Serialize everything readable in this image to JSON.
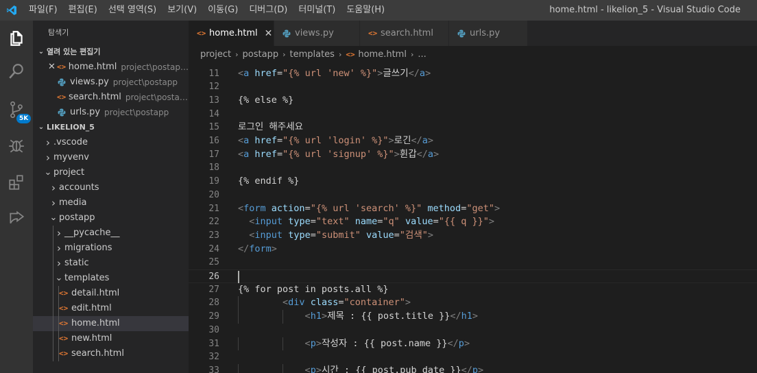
{
  "titlebar": {
    "menu": [
      "파일(F)",
      "편집(E)",
      "선택 영역(S)",
      "보기(V)",
      "이동(G)",
      "디버그(D)",
      "터미널(T)",
      "도움말(H)"
    ],
    "window_title": "home.html - likelion_5 - Visual Studio Code"
  },
  "activitybar": {
    "items": [
      "explorer-icon",
      "search-icon",
      "source-control-icon",
      "debug-icon",
      "extensions-icon",
      "remote-share-icon"
    ],
    "scm_badge": "5K",
    "accent": "#007acc"
  },
  "sidebar": {
    "title": "탐색기",
    "open_editors": {
      "header": "열려 있는 편집기",
      "items": [
        {
          "name": "home.html",
          "path": "project\\postapp...",
          "type": "html"
        },
        {
          "name": "views.py",
          "path": "project\\postapp",
          "type": "py"
        },
        {
          "name": "search.html",
          "path": "project\\postap...",
          "type": "html"
        },
        {
          "name": "urls.py",
          "path": "project\\postapp",
          "type": "py"
        }
      ]
    },
    "workspace": {
      "header": "LIKELION_5",
      "tree": [
        {
          "name": ".vscode",
          "kind": "folder",
          "expanded": false,
          "depth": 0
        },
        {
          "name": "myvenv",
          "kind": "folder",
          "expanded": false,
          "depth": 0
        },
        {
          "name": "project",
          "kind": "folder",
          "expanded": true,
          "depth": 0
        },
        {
          "name": "accounts",
          "kind": "folder",
          "expanded": false,
          "depth": 1
        },
        {
          "name": "media",
          "kind": "folder",
          "expanded": false,
          "depth": 1
        },
        {
          "name": "postapp",
          "kind": "folder",
          "expanded": true,
          "depth": 1
        },
        {
          "name": "__pycache__",
          "kind": "folder",
          "expanded": false,
          "depth": 2
        },
        {
          "name": "migrations",
          "kind": "folder",
          "expanded": false,
          "depth": 2
        },
        {
          "name": "static",
          "kind": "folder",
          "expanded": false,
          "depth": 2
        },
        {
          "name": "templates",
          "kind": "folder",
          "expanded": true,
          "depth": 2
        },
        {
          "name": "detail.html",
          "kind": "html",
          "depth": 3
        },
        {
          "name": "edit.html",
          "kind": "html",
          "depth": 3
        },
        {
          "name": "home.html",
          "kind": "html",
          "depth": 3,
          "selected": true
        },
        {
          "name": "new.html",
          "kind": "html",
          "depth": 3
        },
        {
          "name": "search.html",
          "kind": "html",
          "depth": 3
        }
      ]
    }
  },
  "tabs": [
    {
      "label": "home.html",
      "type": "html",
      "active": true
    },
    {
      "label": "views.py",
      "type": "py",
      "active": false
    },
    {
      "label": "search.html",
      "type": "html",
      "active": false
    },
    {
      "label": "urls.py",
      "type": "py",
      "active": false
    }
  ],
  "breadcrumb": [
    "project",
    "postapp",
    "templates",
    "home.html",
    "..."
  ],
  "editor": {
    "current_line": 26,
    "lines": [
      {
        "n": 11,
        "tokens": [
          [
            "t-br",
            "<"
          ],
          [
            "t-tag",
            "a"
          ],
          [
            "t-txt",
            " "
          ],
          [
            "t-attr",
            "href"
          ],
          [
            "t-txt",
            "="
          ],
          [
            "t-str",
            "\"{% url 'new' %}\""
          ],
          [
            "t-br",
            ">"
          ],
          [
            "t-txt",
            "글쓰기"
          ],
          [
            "t-br",
            "</"
          ],
          [
            "t-tag",
            "a"
          ],
          [
            "t-br",
            ">"
          ]
        ]
      },
      {
        "n": 12,
        "tokens": []
      },
      {
        "n": 13,
        "tokens": [
          [
            "t-txt",
            "{% else %}"
          ]
        ]
      },
      {
        "n": 14,
        "tokens": []
      },
      {
        "n": 15,
        "tokens": [
          [
            "t-txt",
            "로그인 해주세요"
          ]
        ]
      },
      {
        "n": 16,
        "tokens": [
          [
            "t-br",
            "<"
          ],
          [
            "t-tag",
            "a"
          ],
          [
            "t-txt",
            " "
          ],
          [
            "t-attr",
            "href"
          ],
          [
            "t-txt",
            "="
          ],
          [
            "t-str",
            "\"{% url 'login' %}\""
          ],
          [
            "t-br",
            ">"
          ],
          [
            "t-txt",
            "로긴"
          ],
          [
            "t-br",
            "</"
          ],
          [
            "t-tag",
            "a"
          ],
          [
            "t-br",
            ">"
          ]
        ]
      },
      {
        "n": 17,
        "tokens": [
          [
            "t-br",
            "<"
          ],
          [
            "t-tag",
            "a"
          ],
          [
            "t-txt",
            " "
          ],
          [
            "t-attr",
            "href"
          ],
          [
            "t-txt",
            "="
          ],
          [
            "t-str",
            "\"{% url 'signup' %}\""
          ],
          [
            "t-br",
            ">"
          ],
          [
            "t-txt",
            "휜갑"
          ],
          [
            "t-br",
            "</"
          ],
          [
            "t-tag",
            "a"
          ],
          [
            "t-br",
            ">"
          ]
        ]
      },
      {
        "n": 18,
        "tokens": []
      },
      {
        "n": 19,
        "tokens": [
          [
            "t-txt",
            "{% endif %}"
          ]
        ]
      },
      {
        "n": 20,
        "tokens": []
      },
      {
        "n": 21,
        "tokens": [
          [
            "t-br",
            "<"
          ],
          [
            "t-tag",
            "form"
          ],
          [
            "t-txt",
            " "
          ],
          [
            "t-attr",
            "action"
          ],
          [
            "t-txt",
            "="
          ],
          [
            "t-str",
            "\"{% url 'search' %}\""
          ],
          [
            "t-txt",
            " "
          ],
          [
            "t-attr",
            "method"
          ],
          [
            "t-txt",
            "="
          ],
          [
            "t-str",
            "\"get\""
          ],
          [
            "t-br",
            ">"
          ]
        ]
      },
      {
        "n": 22,
        "tokens": [
          [
            "t-txt",
            "  "
          ],
          [
            "t-br",
            "<"
          ],
          [
            "t-tag",
            "input"
          ],
          [
            "t-txt",
            " "
          ],
          [
            "t-attr",
            "type"
          ],
          [
            "t-txt",
            "="
          ],
          [
            "t-str",
            "\"text\""
          ],
          [
            "t-txt",
            " "
          ],
          [
            "t-attr",
            "name"
          ],
          [
            "t-txt",
            "="
          ],
          [
            "t-str",
            "\"q\""
          ],
          [
            "t-txt",
            " "
          ],
          [
            "t-attr",
            "value"
          ],
          [
            "t-txt",
            "="
          ],
          [
            "t-str",
            "\"{{ q }}\""
          ],
          [
            "t-br",
            ">"
          ]
        ]
      },
      {
        "n": 23,
        "tokens": [
          [
            "t-txt",
            "  "
          ],
          [
            "t-br",
            "<"
          ],
          [
            "t-tag",
            "input"
          ],
          [
            "t-txt",
            " "
          ],
          [
            "t-attr",
            "type"
          ],
          [
            "t-txt",
            "="
          ],
          [
            "t-str",
            "\"submit\""
          ],
          [
            "t-txt",
            " "
          ],
          [
            "t-attr",
            "value"
          ],
          [
            "t-txt",
            "="
          ],
          [
            "t-str",
            "\"검색\""
          ],
          [
            "t-br",
            ">"
          ]
        ]
      },
      {
        "n": 24,
        "tokens": [
          [
            "t-br",
            "</"
          ],
          [
            "t-tag",
            "form"
          ],
          [
            "t-br",
            ">"
          ]
        ]
      },
      {
        "n": 25,
        "tokens": []
      },
      {
        "n": 26,
        "tokens": []
      },
      {
        "n": 27,
        "tokens": [
          [
            "t-txt",
            "{% for post in posts.all %}"
          ]
        ]
      },
      {
        "n": 28,
        "tokens": [
          [
            "t-txt",
            "        "
          ],
          [
            "t-br",
            "<"
          ],
          [
            "t-tag",
            "div"
          ],
          [
            "t-txt",
            " "
          ],
          [
            "t-attr",
            "class"
          ],
          [
            "t-txt",
            "="
          ],
          [
            "t-str",
            "\"container\""
          ],
          [
            "t-br",
            ">"
          ]
        ]
      },
      {
        "n": 29,
        "tokens": [
          [
            "t-txt",
            "            "
          ],
          [
            "t-br",
            "<"
          ],
          [
            "t-tag",
            "h1"
          ],
          [
            "t-br",
            ">"
          ],
          [
            "t-txt",
            "제목 : {{ post.title }}"
          ],
          [
            "t-br",
            "</"
          ],
          [
            "t-tag",
            "h1"
          ],
          [
            "t-br",
            ">"
          ]
        ]
      },
      {
        "n": 30,
        "tokens": []
      },
      {
        "n": 31,
        "tokens": [
          [
            "t-txt",
            "            "
          ],
          [
            "t-br",
            "<"
          ],
          [
            "t-tag",
            "p"
          ],
          [
            "t-br",
            ">"
          ],
          [
            "t-txt",
            "작성자 : {{ post.name }}"
          ],
          [
            "t-br",
            "</"
          ],
          [
            "t-tag",
            "p"
          ],
          [
            "t-br",
            ">"
          ]
        ]
      },
      {
        "n": 32,
        "tokens": []
      },
      {
        "n": 33,
        "tokens": [
          [
            "t-txt",
            "            "
          ],
          [
            "t-br",
            "<"
          ],
          [
            "t-tag",
            "p"
          ],
          [
            "t-br",
            ">"
          ],
          [
            "t-txt",
            "시간 : {{ post.pub_date }}"
          ],
          [
            "t-br",
            "</"
          ],
          [
            "t-tag",
            "p"
          ],
          [
            "t-br",
            ">"
          ]
        ]
      }
    ]
  }
}
